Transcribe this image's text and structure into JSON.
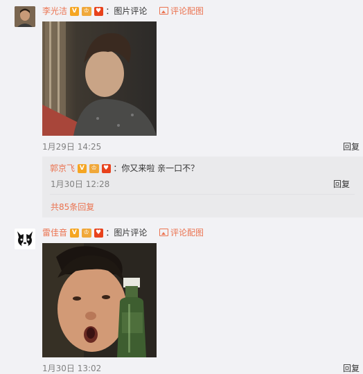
{
  "comments": [
    {
      "user": "李光洁",
      "badges": [
        "V",
        "vip",
        "红包"
      ],
      "mode_text": "：图片评论",
      "link_text": "评论配图",
      "timestamp": "1月29日 14:25",
      "reply_label": "回复"
    },
    {
      "user": "雷佳音",
      "badges": [
        "V",
        "vip",
        "红包"
      ],
      "mode_text": "：图片评论",
      "link_text": "评论配图",
      "timestamp": "1月30日 13:02",
      "reply_label": "回复"
    }
  ],
  "subcomment": {
    "user": "郭京飞",
    "text": "：你又来啦 亲一口不？",
    "timestamp": "1月30日 12:28",
    "reply_label": "回复",
    "more_replies": "共85条回复"
  },
  "colors": {
    "background": "#f2f2f5",
    "username": "#eb7350",
    "timestamp": "#808080",
    "subcomment_bg": "#eaeaec"
  }
}
